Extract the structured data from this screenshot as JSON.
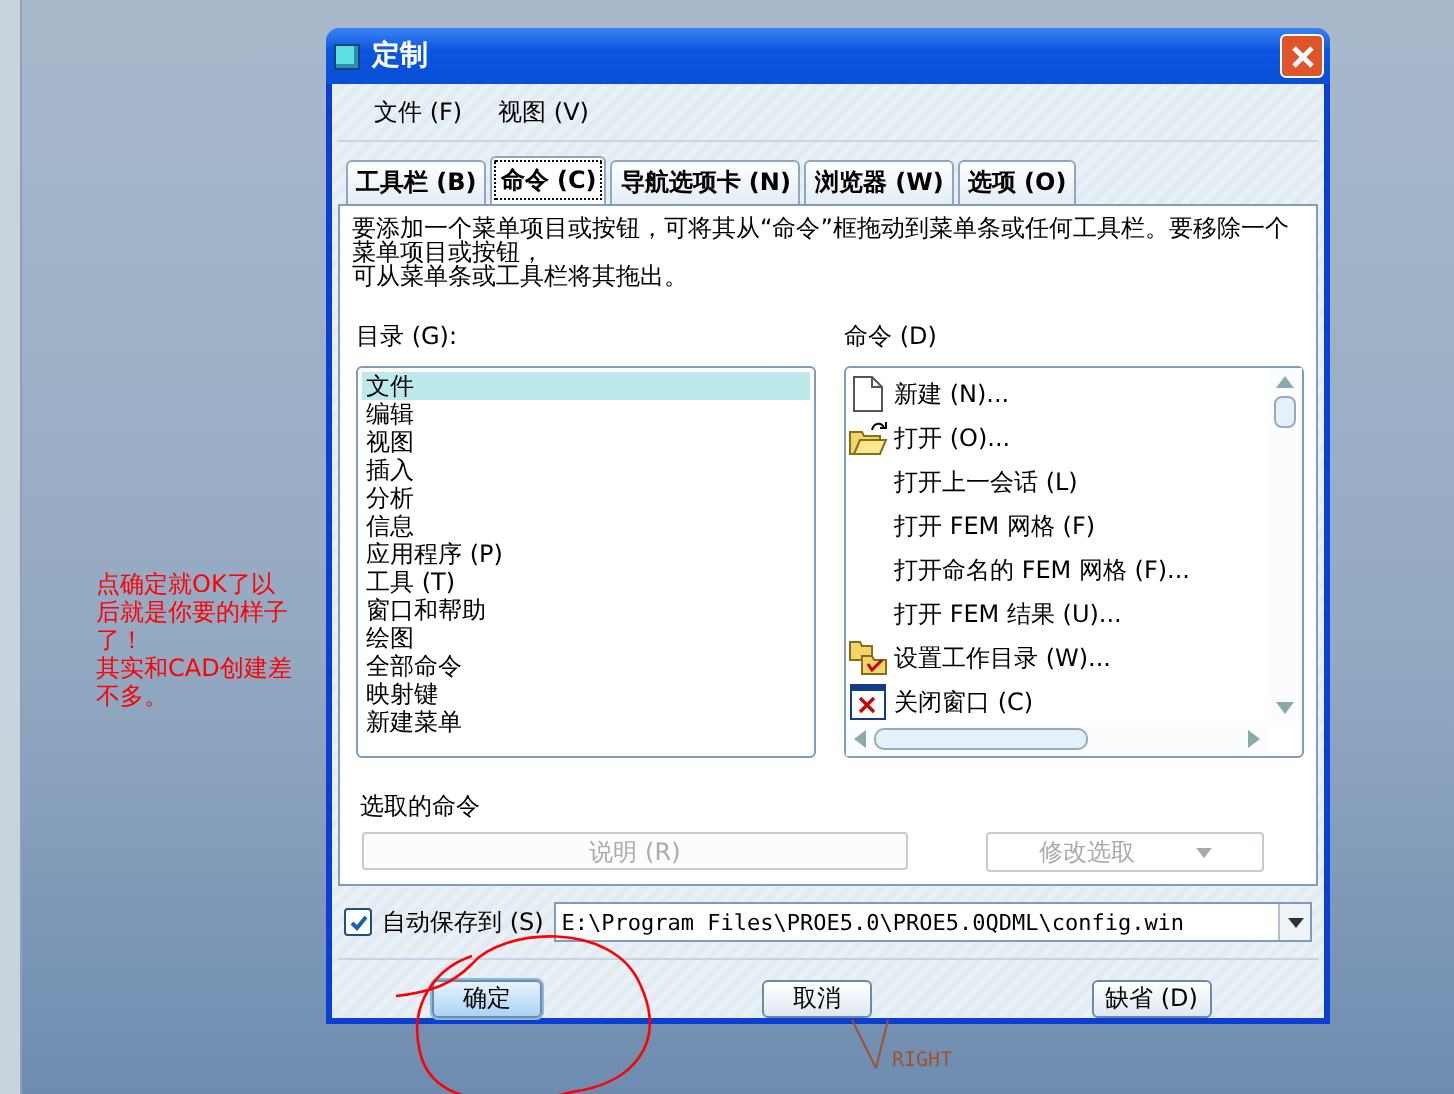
{
  "window": {
    "title": "定制"
  },
  "menu": [
    "文件 (F)",
    "视图 (V)"
  ],
  "tabs": [
    {
      "label": "工具栏 (B)",
      "selected": false
    },
    {
      "label": "命令 (C)",
      "selected": true
    },
    {
      "label": "导航选项卡 (N)",
      "selected": false
    },
    {
      "label": "浏览器 (W)",
      "selected": false
    },
    {
      "label": "选项 (O)",
      "selected": false
    }
  ],
  "instructions": [
    "要添加一个菜单项目或按钮，可将其从“命令”框拖动到菜单条或任何工具栏。要移除一个菜单项目或按钮，",
    "可从菜单条或工具栏将其拖出。"
  ],
  "categories": {
    "label": "目录 (G):",
    "items": [
      {
        "label": "文件",
        "selected": true
      },
      {
        "label": "编辑",
        "selected": false
      },
      {
        "label": "视图",
        "selected": false
      },
      {
        "label": "插入",
        "selected": false
      },
      {
        "label": "分析",
        "selected": false
      },
      {
        "label": "信息",
        "selected": false
      },
      {
        "label": "应用程序 (P)",
        "selected": false
      },
      {
        "label": "工具 (T)",
        "selected": false
      },
      {
        "label": "窗口和帮助",
        "selected": false
      },
      {
        "label": "绘图",
        "selected": false
      },
      {
        "label": "全部命令",
        "selected": false
      },
      {
        "label": "映射键",
        "selected": false
      },
      {
        "label": "新建菜单",
        "selected": false
      }
    ]
  },
  "commands": {
    "label": "命令 (D)",
    "items": [
      {
        "label": "新建 (N)...",
        "kind": "new"
      },
      {
        "label": "打开 (O)...",
        "kind": "open"
      },
      {
        "label": "打开上一会话 (L)",
        "kind": "plain"
      },
      {
        "label": "打开 FEM 网格 (F)",
        "kind": "plain"
      },
      {
        "label": "打开命名的 FEM 网格 (F)...",
        "kind": "plain"
      },
      {
        "label": "打开 FEM 结果 (U)...",
        "kind": "plain"
      },
      {
        "label": "设置工作目录 (W)...",
        "kind": "workdir"
      },
      {
        "label": "关闭窗口 (C)",
        "kind": "close"
      }
    ]
  },
  "selected_command": {
    "label": "选取的命令",
    "description_button": {
      "label": "说明 (R)",
      "disabled": true
    },
    "modify_dropdown": {
      "label": "修改选取",
      "disabled": true
    }
  },
  "autosave": {
    "checked": true,
    "label": "自动保存到 (S)",
    "value": "E:\\Program Files\\PROE5.0\\PROE5.0QDML\\config.win"
  },
  "buttons": [
    {
      "label": "确定",
      "default": true
    },
    {
      "label": "取消",
      "default": false
    },
    {
      "label": "缺省 (D)",
      "default": false
    }
  ],
  "annotation": [
    "点确定就OK了以后就是你要的样子了！",
    "其实和CAD创建差不多。"
  ],
  "datum_label": "RIGHT"
}
